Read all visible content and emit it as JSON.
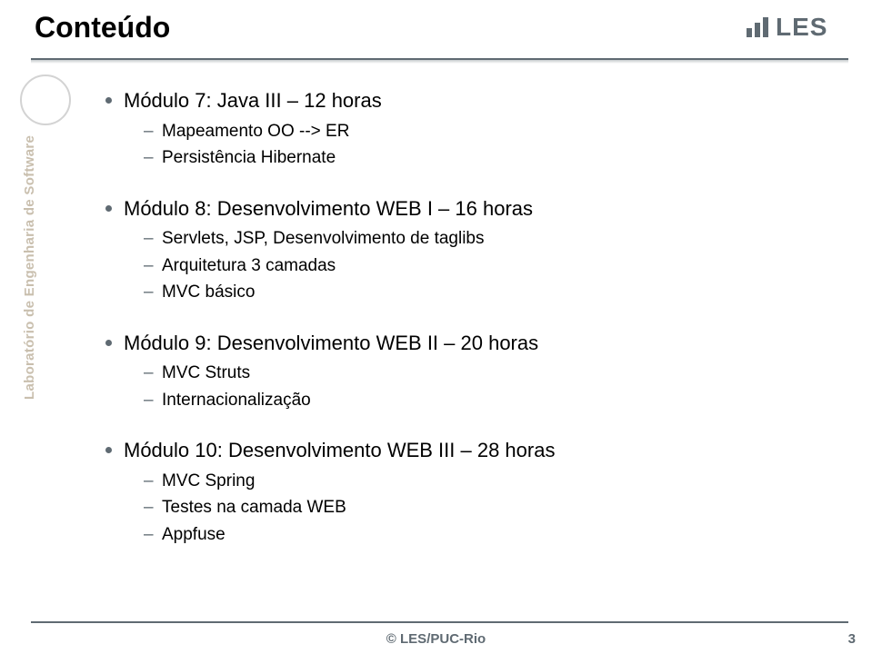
{
  "title": "Conteúdo",
  "logo_text": "LES",
  "sidebar_label": "Laboratório de Engenharia de Software",
  "modules": [
    {
      "title": "Módulo 7: Java III – 12 horas",
      "items": [
        "Mapeamento OO --> ER",
        "Persistência Hibernate"
      ]
    },
    {
      "title": "Módulo 8: Desenvolvimento WEB I – 16 horas",
      "items": [
        "Servlets, JSP, Desenvolvimento de taglibs",
        "Arquitetura 3 camadas",
        "MVC básico"
      ]
    },
    {
      "title": "Módulo 9: Desenvolvimento WEB II – 20 horas",
      "items": [
        "MVC Struts",
        "Internacionalização"
      ]
    },
    {
      "title": "Módulo 10: Desenvolvimento WEB III – 28 horas",
      "items": [
        "MVC Spring",
        "Testes na camada WEB",
        "Appfuse"
      ]
    }
  ],
  "footer": "© LES/PUC-Rio",
  "page_number": "3"
}
